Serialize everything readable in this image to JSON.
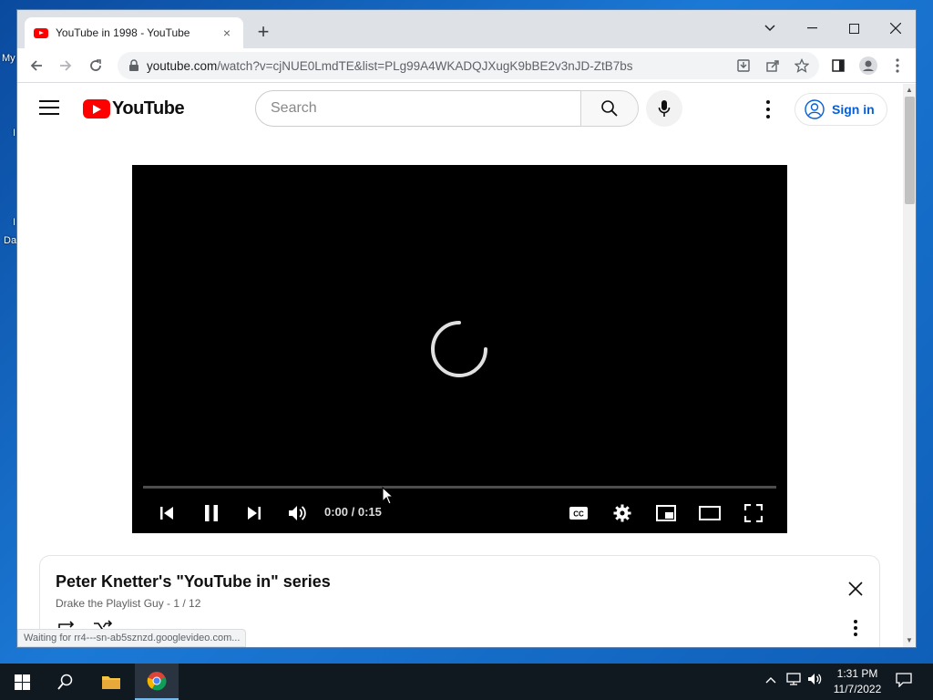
{
  "desktop": {
    "icon_labels": [
      "My",
      "I",
      "I",
      "Da"
    ]
  },
  "browser": {
    "tab_title": "YouTube in 1998 - YouTube",
    "tab_close": "×",
    "new_tab": "+",
    "url_host": "youtube.com",
    "url_rest": "/watch?v=cjNUE0LmdTE&list=PLg99A4WKADQJXugK9bBE2v3nJD-ZtB7bs",
    "status_text": "Waiting for rr4---sn-ab5sznzd.googlevideo.com..."
  },
  "youtube": {
    "logo_text": "YouTube",
    "search_placeholder": "Search",
    "sign_in": "Sign in",
    "player": {
      "time_display": "0:00 / 0:15",
      "progress": 0
    },
    "playlist": {
      "title": "Peter Knetter's \"YouTube in\" series",
      "subtitle": "Drake the Playlist Guy - 1 / 12"
    }
  },
  "taskbar": {
    "time": "1:31 PM",
    "date": "11/7/2022"
  },
  "colors": {
    "youtube_red": "#ff0000",
    "link_blue": "#065fd4",
    "player_bg": "#000000",
    "taskbar": "#101820"
  },
  "icons": [
    "youtube-favicon-icon",
    "back-icon",
    "forward-icon",
    "reload-icon",
    "lock-icon",
    "install-icon",
    "share-icon",
    "star-icon",
    "sidepanel-icon",
    "profile-icon",
    "menu-icon",
    "search-icon",
    "mic-icon",
    "account-icon",
    "previous-icon",
    "pause-icon",
    "next-icon",
    "volume-icon",
    "captions-icon",
    "settings-icon",
    "miniplayer-icon",
    "theater-icon",
    "fullscreen-icon",
    "loop-icon",
    "shuffle-icon",
    "close-icon",
    "windows-start-icon",
    "search-taskbar-icon",
    "file-explorer-icon",
    "chrome-icon",
    "notification-icon"
  ]
}
